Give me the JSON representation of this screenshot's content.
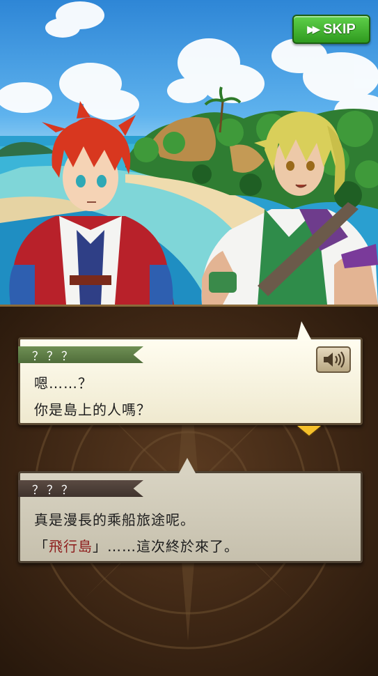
{
  "skip_button": {
    "label": "SKIP",
    "icon": "fast-forward-icon"
  },
  "dialog_current": {
    "speaker": "？？？",
    "lines": [
      "嗯……？",
      "你是島上的人嗎？"
    ],
    "voice_icon": "speaker-icon"
  },
  "dialog_previous": {
    "speaker": "？？？",
    "line1": "真是漫長的乘船旅途呢。",
    "line2_open": "「",
    "line2_highlight": "飛行島",
    "line2_close": "」……這次終於來了。"
  },
  "colors": {
    "skip_green": "#3fb32c",
    "name_tag_active": "#5f7f47",
    "name_tag_inactive": "#4a3d36",
    "highlight_red": "#8e1d1d",
    "next_arrow": "#f5c02a"
  }
}
